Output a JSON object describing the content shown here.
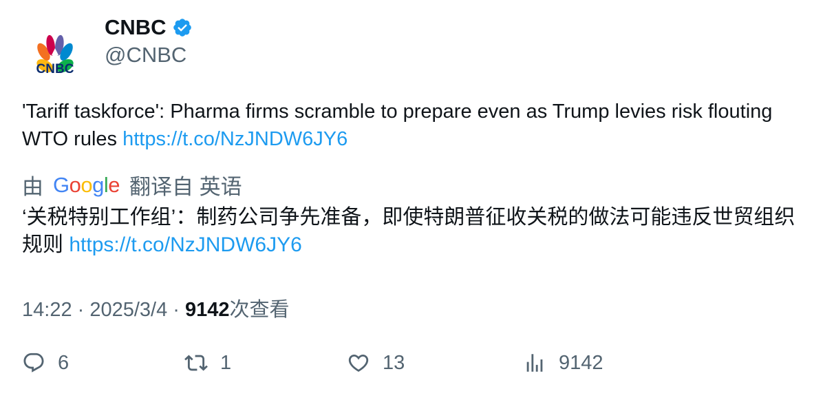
{
  "author": {
    "display_name": "CNBC",
    "handle": "@CNBC",
    "avatar_text": "CNBC",
    "verified_color": "#1d9bf0"
  },
  "tweet": {
    "text": "'Tariff taskforce': Pharma firms scramble to prepare even as Trump levies risk flouting WTO rules ",
    "link": "https://t.co/NzJNDW6JY6"
  },
  "translation": {
    "prefix": "由",
    "provider": "Google",
    "suffix": "翻译自 英语",
    "text": "‘关税特别工作组’：制药公司争先准备，即使特朗普征收关税的做法可能违反世贸组织规则 ",
    "link": "https://t.co/NzJNDW6JY6"
  },
  "meta": {
    "time": "14:22",
    "separator": " · ",
    "date": "2025/3/4",
    "views": "9142",
    "views_label": "次查看"
  },
  "actions": {
    "replies": "6",
    "retweets": "1",
    "likes": "13",
    "views": "9142"
  },
  "colors": {
    "link": "#1d9bf0",
    "muted": "#536471",
    "text": "#0f1419"
  }
}
